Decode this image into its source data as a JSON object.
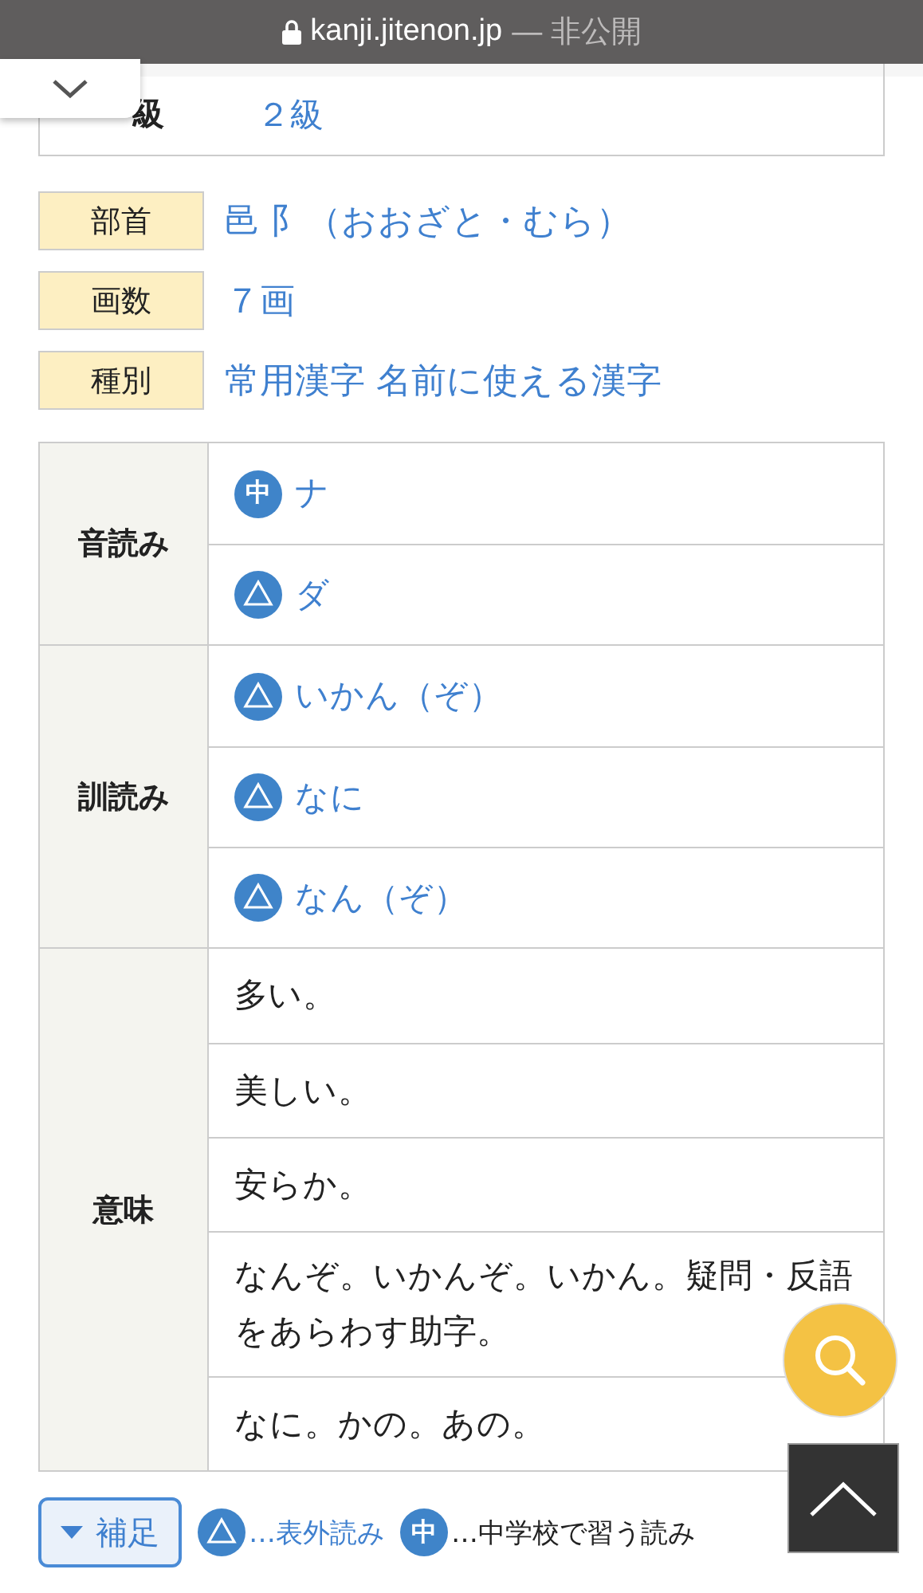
{
  "browser_bar": {
    "domain": "kanji.jitenon.jp",
    "privacy": "— 非公開"
  },
  "grade": {
    "label": "級",
    "value": "２級"
  },
  "info": [
    {
      "label": "部首",
      "value": "邑 阝（おおざと・むら）"
    },
    {
      "label": "画数",
      "value": "７画"
    },
    {
      "label": "種別",
      "value": "常用漢字 名前に使える漢字"
    }
  ],
  "readings": [
    {
      "header": "音読み",
      "items": [
        {
          "kind": "middle",
          "badge": "中",
          "text": "ナ"
        },
        {
          "kind": "outside",
          "text": "ダ"
        }
      ]
    },
    {
      "header": "訓読み",
      "items": [
        {
          "kind": "outside",
          "text": "いかん（ぞ）"
        },
        {
          "kind": "outside",
          "text": "なに"
        },
        {
          "kind": "outside",
          "text": "なん（ぞ）"
        }
      ]
    },
    {
      "header": "意味",
      "items": [
        {
          "kind": "plain",
          "text": "多い。"
        },
        {
          "kind": "plain",
          "text": "美しい。"
        },
        {
          "kind": "plain",
          "text": "安らか。"
        },
        {
          "kind": "plain",
          "text": "なんぞ。いかんぞ。いかん。疑問・反語をあらわす助字。"
        },
        {
          "kind": "plain",
          "text": "なに。かの。あの。"
        }
      ]
    }
  ],
  "footer": {
    "toggle": "補足",
    "legend": [
      {
        "kind": "outside",
        "text": "…表外読み",
        "link": true
      },
      {
        "kind": "middle",
        "badge": "中",
        "text": "…中学校で習う読み",
        "link": false
      }
    ]
  }
}
